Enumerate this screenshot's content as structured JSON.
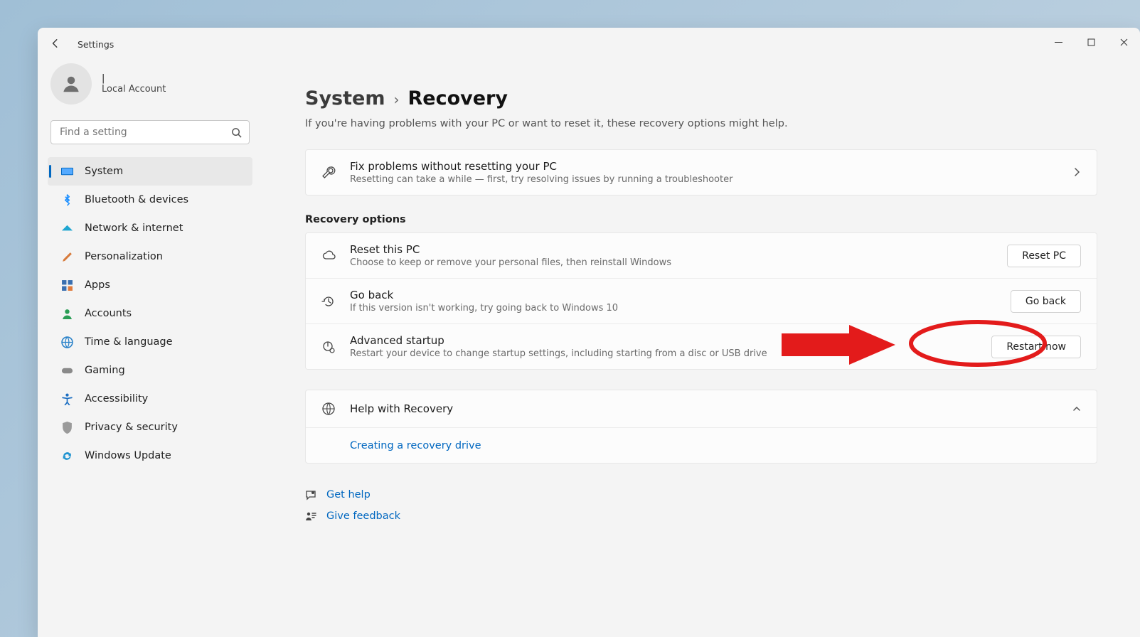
{
  "window": {
    "app_name": "Settings"
  },
  "profile": {
    "name": "|",
    "subtitle": "Local Account"
  },
  "search": {
    "placeholder": "Find a setting"
  },
  "sidebar": {
    "items": [
      {
        "label": "System"
      },
      {
        "label": "Bluetooth & devices"
      },
      {
        "label": "Network & internet"
      },
      {
        "label": "Personalization"
      },
      {
        "label": "Apps"
      },
      {
        "label": "Accounts"
      },
      {
        "label": "Time & language"
      },
      {
        "label": "Gaming"
      },
      {
        "label": "Accessibility"
      },
      {
        "label": "Privacy & security"
      },
      {
        "label": "Windows Update"
      }
    ]
  },
  "breadcrumb": {
    "parent": "System",
    "current": "Recovery"
  },
  "intro": "If you're having problems with your PC or want to reset it, these recovery options might help.",
  "fix": {
    "title": "Fix problems without resetting your PC",
    "desc": "Resetting can take a while — first, try resolving issues by running a troubleshooter"
  },
  "section_label": "Recovery options",
  "options": [
    {
      "title": "Reset this PC",
      "desc": "Choose to keep or remove your personal files, then reinstall Windows",
      "button": "Reset PC"
    },
    {
      "title": "Go back",
      "desc": "If this version isn't working, try going back to Windows 10",
      "button": "Go back"
    },
    {
      "title": "Advanced startup",
      "desc": "Restart your device to change startup settings, including starting from a disc or USB drive",
      "button": "Restart now"
    }
  ],
  "help": {
    "title": "Help with Recovery",
    "link": "Creating a recovery drive"
  },
  "footer": {
    "get_help": "Get help",
    "give_feedback": "Give feedback"
  },
  "annotation": {
    "highlight_target": "go-back-button"
  }
}
